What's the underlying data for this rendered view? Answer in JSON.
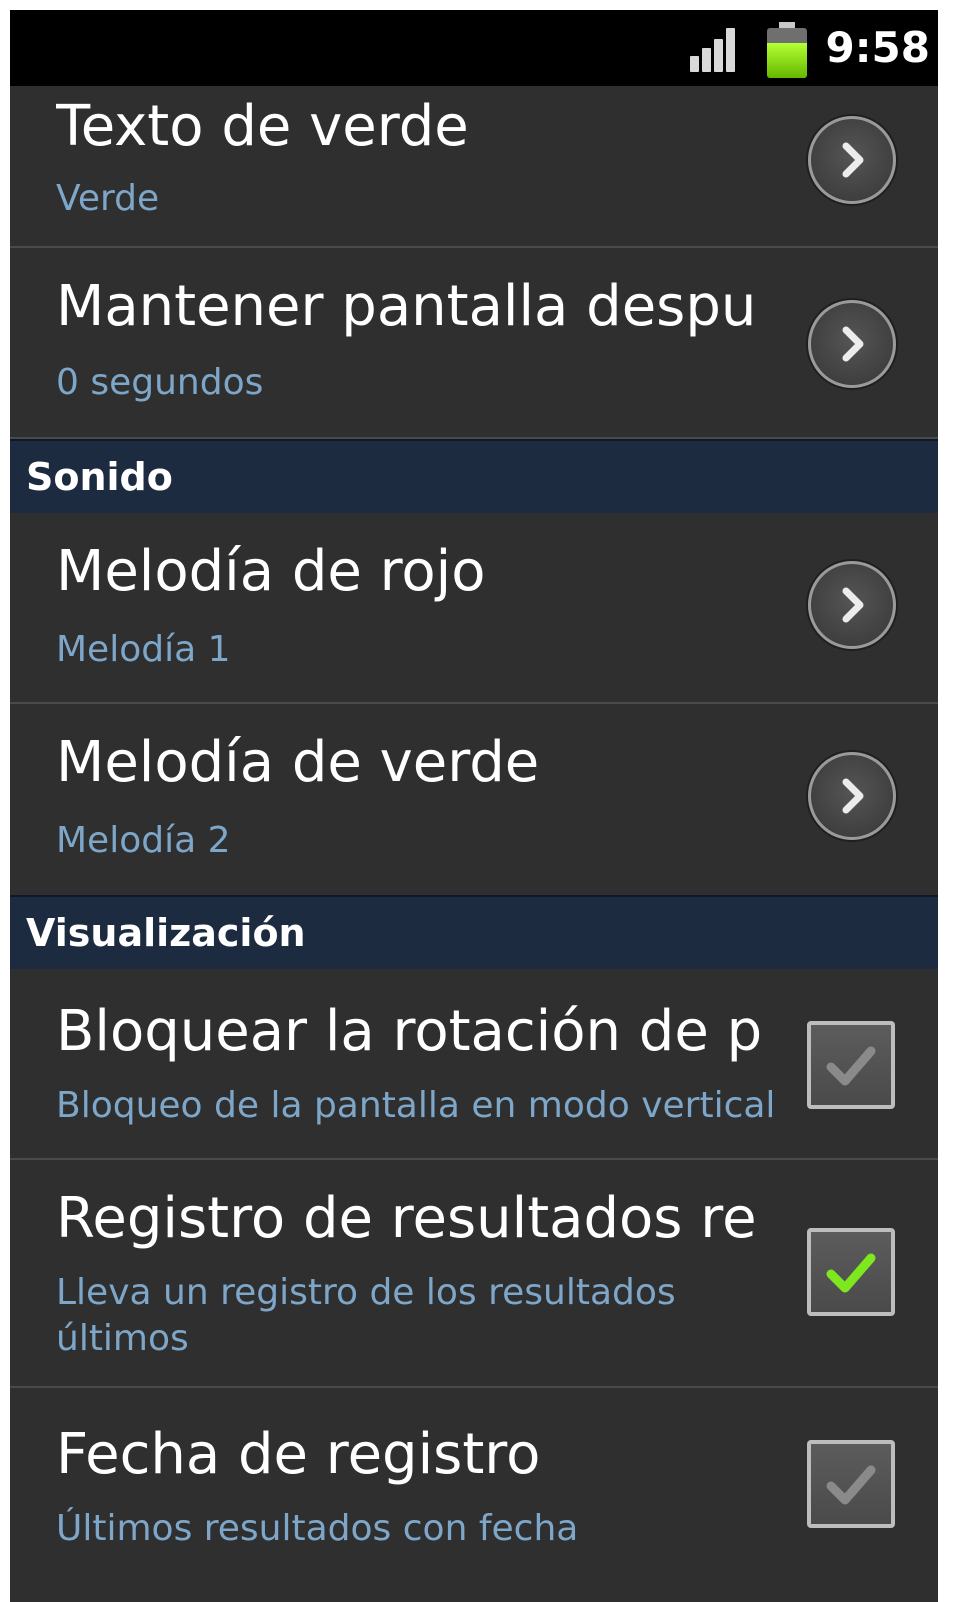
{
  "status_bar": {
    "time": "9:58",
    "battery_level": 0.7,
    "signal_bars": 4
  },
  "rows": [
    {
      "title": "Texto de verde",
      "summary": "Verde",
      "widget": "chevron-icon"
    },
    {
      "title": "Mantener pantalla despu",
      "summary": "0 segundos",
      "widget": "chevron-icon"
    }
  ],
  "sections": {
    "sonido": {
      "label": "Sonido",
      "rows": [
        {
          "title": "Melodía de rojo",
          "summary": "Melodía 1",
          "widget": "chevron-icon"
        },
        {
          "title": "Melodía de verde",
          "summary": "Melodía 2",
          "widget": "chevron-icon"
        }
      ]
    },
    "visualizacion": {
      "label": "Visualización",
      "rows": [
        {
          "title": "Bloquear la rotación de p",
          "summary": "Bloqueo de la pantalla en modo vertical",
          "checked": false
        },
        {
          "title": "Registro de resultados re",
          "summary": "Lleva un registro de los resultados últimos",
          "checked": true
        },
        {
          "title": "Fecha de registro",
          "summary": "Últimos resultados con fecha",
          "checked": false
        }
      ]
    }
  },
  "colors": {
    "background": "#2f2f2f",
    "summary_text": "#7ea6c8",
    "section_header": "#1c2b40",
    "check_on": "#7ee81e",
    "check_off": "#8a8a8a"
  }
}
